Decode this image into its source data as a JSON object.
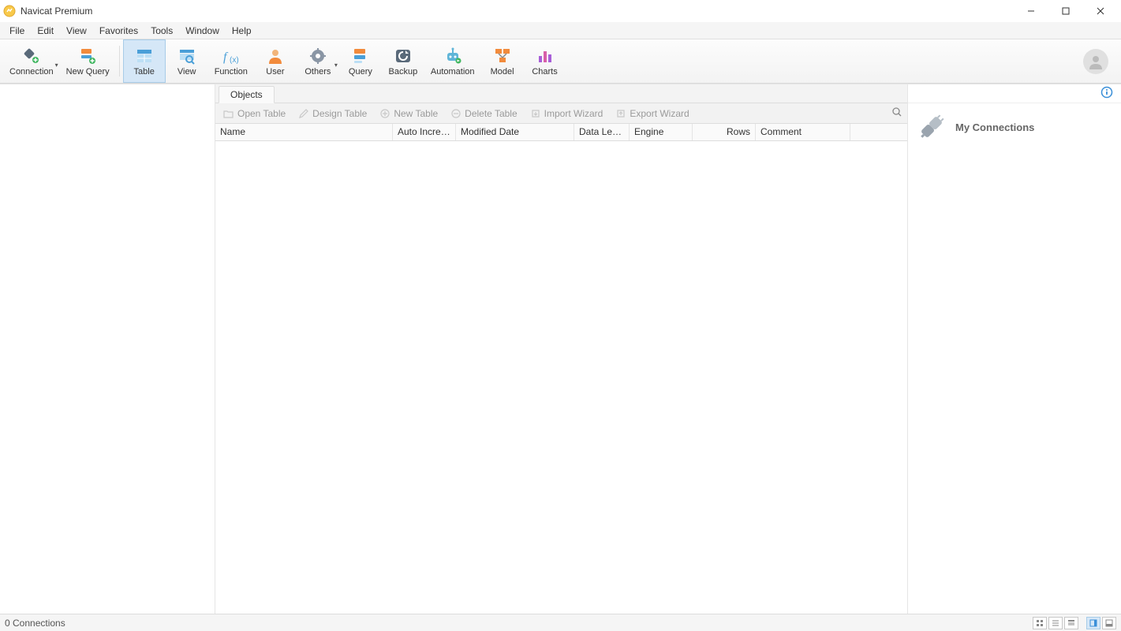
{
  "window": {
    "title": "Navicat Premium"
  },
  "menu": [
    "File",
    "Edit",
    "View",
    "Favorites",
    "Tools",
    "Window",
    "Help"
  ],
  "toolbar": [
    {
      "id": "connection",
      "label": "Connection",
      "hasDrop": true
    },
    {
      "id": "new-query",
      "label": "New Query"
    },
    {
      "id": "table",
      "label": "Table",
      "active": true
    },
    {
      "id": "view",
      "label": "View"
    },
    {
      "id": "function",
      "label": "Function"
    },
    {
      "id": "user",
      "label": "User"
    },
    {
      "id": "others",
      "label": "Others",
      "hasDrop": true
    },
    {
      "id": "query",
      "label": "Query"
    },
    {
      "id": "backup",
      "label": "Backup"
    },
    {
      "id": "automation",
      "label": "Automation"
    },
    {
      "id": "model",
      "label": "Model"
    },
    {
      "id": "charts",
      "label": "Charts"
    }
  ],
  "tabs": {
    "objects": "Objects"
  },
  "actions": {
    "open_table": "Open Table",
    "design_table": "Design Table",
    "new_table": "New Table",
    "delete_table": "Delete Table",
    "import_wizard": "Import Wizard",
    "export_wizard": "Export Wizard"
  },
  "columns": {
    "name": "Name",
    "auto_increment": "Auto Increm...",
    "modified_date": "Modified Date",
    "data_length": "Data Length",
    "engine": "Engine",
    "rows": "Rows",
    "comment": "Comment"
  },
  "right_panel": {
    "title": "My Connections"
  },
  "statusbar": {
    "text": "0 Connections"
  }
}
